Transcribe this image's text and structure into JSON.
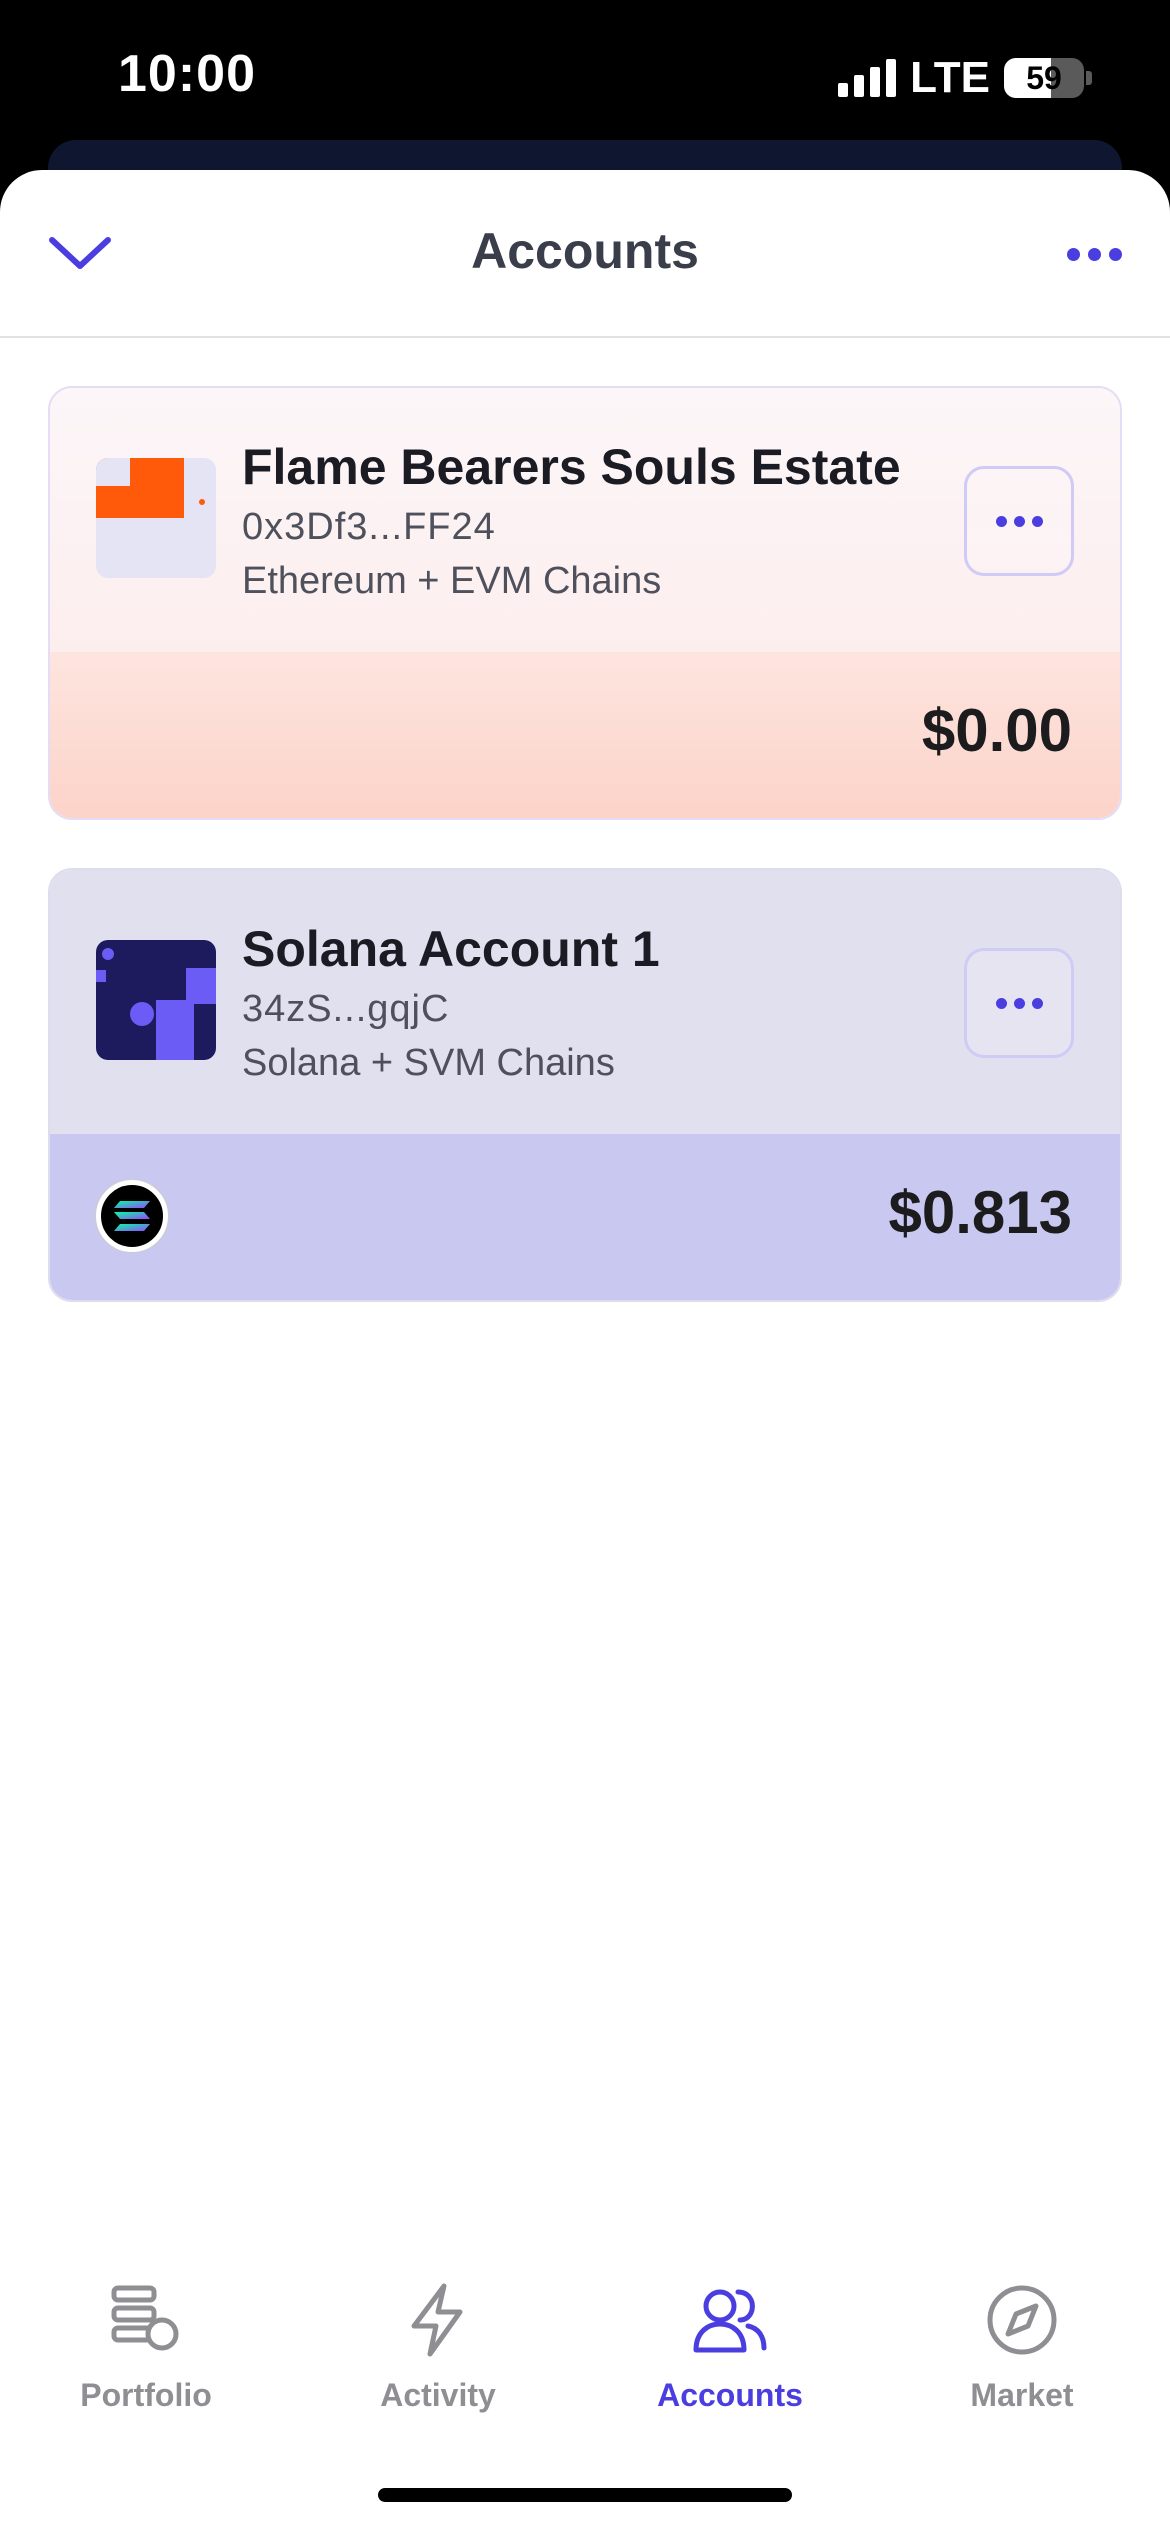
{
  "status_bar": {
    "time": "10:00",
    "network": "LTE",
    "battery": "59"
  },
  "header": {
    "title": "Accounts"
  },
  "accounts": [
    {
      "name": "Flame Bearers Souls Estate",
      "address": "0x3Df3...FF24",
      "chains": "Ethereum + EVM Chains",
      "balance": "$0.00"
    },
    {
      "name": "Solana Account 1",
      "address": "34zS...gqjC",
      "chains": "Solana + SVM Chains",
      "balance": "$0.813"
    }
  ],
  "tabs": [
    {
      "label": "Portfolio",
      "icon": "coins-icon",
      "active": false
    },
    {
      "label": "Activity",
      "icon": "lightning-icon",
      "active": false
    },
    {
      "label": "Accounts",
      "icon": "users-icon",
      "active": true
    },
    {
      "label": "Market",
      "icon": "compass-icon",
      "active": false
    }
  ],
  "colors": {
    "accent": "#4b3ee0",
    "inactive_tab": "#8e8e93"
  }
}
